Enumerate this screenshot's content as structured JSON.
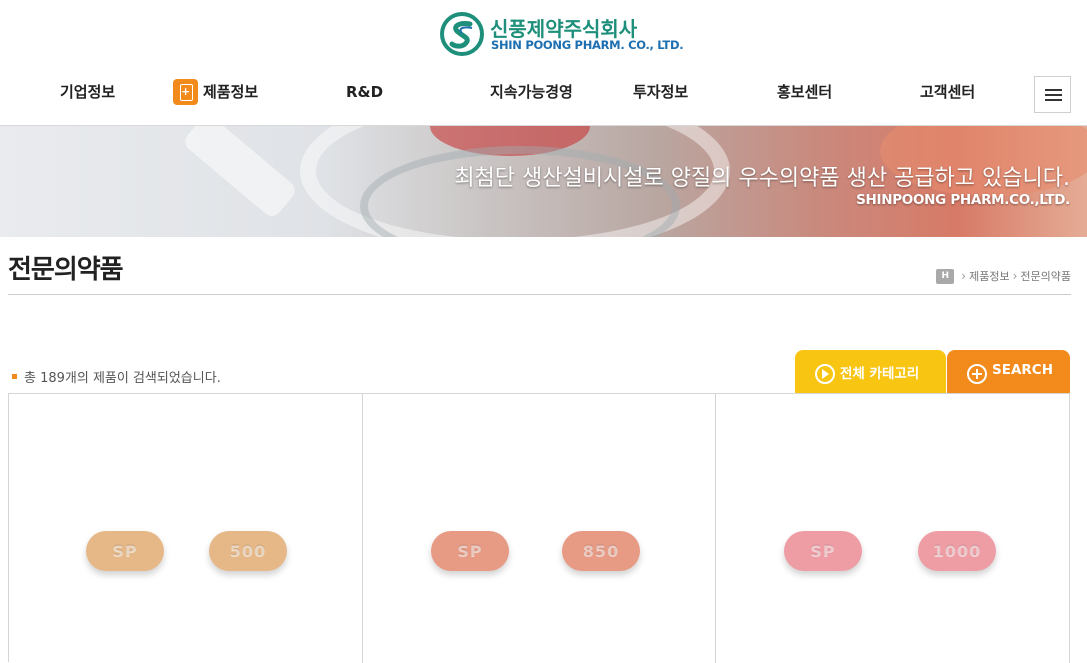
{
  "header": {
    "logo_ko": "신풍제약주식회사",
    "logo_en": "SHIN POONG PHARM. CO., LTD.",
    "nav": [
      {
        "label": "기업정보"
      },
      {
        "label": "제품정보"
      },
      {
        "label": "R&D"
      },
      {
        "label": "지속가능경영"
      },
      {
        "label": "투자정보"
      },
      {
        "label": "홍보센터"
      },
      {
        "label": "고객센터"
      }
    ],
    "menu_icon": "hamburger-menu-icon",
    "brand_color": "#1d8f7a",
    "accent_color": "#f28a1c"
  },
  "banner": {
    "headline": "최첨단 생산설비시설로 양질의 우수의약품 생산 공급하고 있습니다.",
    "company": "SHINPOONG PHARM.CO.,LTD."
  },
  "page": {
    "title": "전문의약품",
    "breadcrumb": {
      "home": "H",
      "items": [
        "제품정보",
        "전문의약품"
      ]
    }
  },
  "results": {
    "text": "총 189개의 제품이 검색되었습니다."
  },
  "buttons": {
    "category": "전체 카테고리",
    "search": "SEARCH",
    "category_color": "#f8c512",
    "search_color": "#f28a1c"
  },
  "products": [
    {
      "marks": [
        "SP",
        "500"
      ],
      "color": "#e6b887"
    },
    {
      "marks": [
        "SP",
        "850"
      ],
      "color": "#e79a84"
    },
    {
      "marks": [
        "SP",
        "1000"
      ],
      "color": "#ef9da5"
    }
  ]
}
